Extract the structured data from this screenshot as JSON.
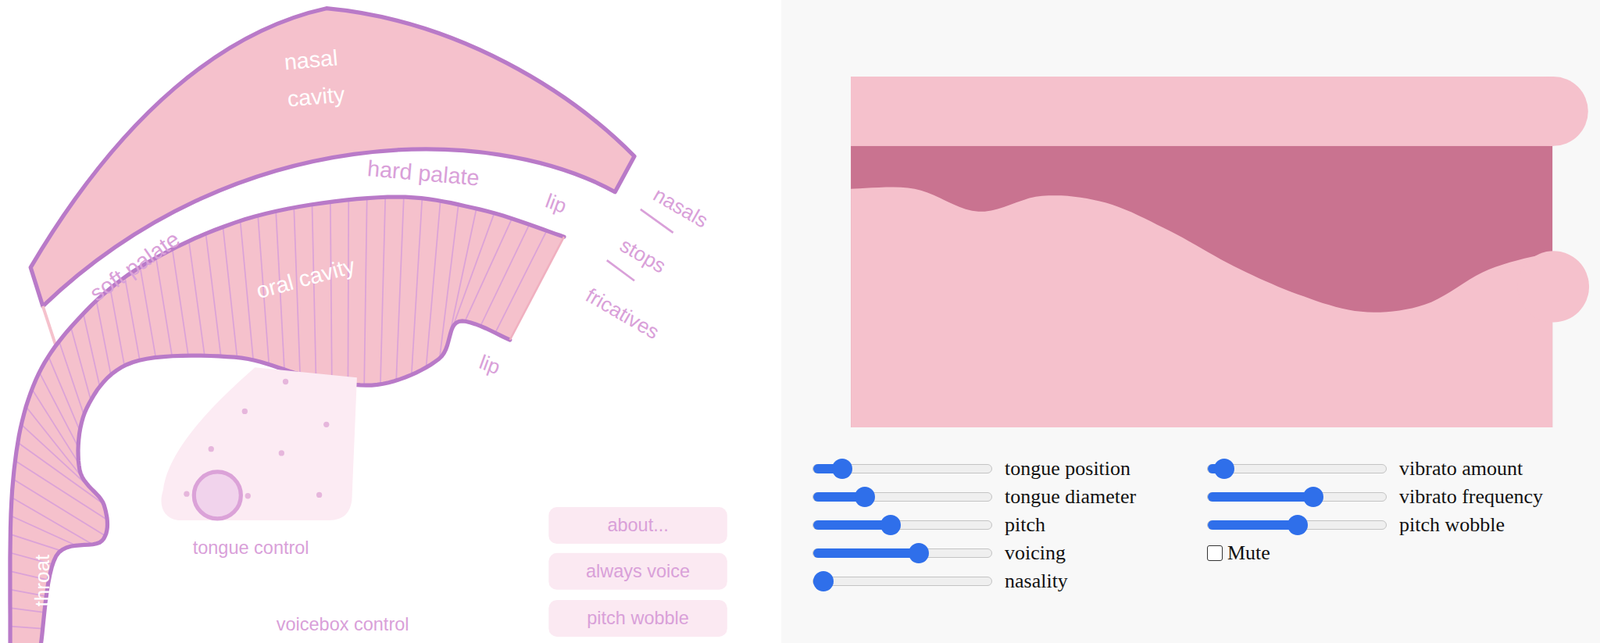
{
  "diagram": {
    "labels": [
      "nasal",
      "cavity",
      "hard palate",
      "soft palate",
      "oral cavity",
      "lip",
      "lip",
      "nasals",
      "stops",
      "fricatives",
      "throat",
      "tongue control",
      "voicebox control"
    ],
    "buttons": [
      "about...",
      "always voice",
      "pitch wobble"
    ]
  },
  "tract": {
    "profile": [
      0.32,
      0.32,
      0.385,
      0.34,
      0.36,
      0.44,
      0.54,
      0.62,
      0.67,
      0.65,
      0.55,
      0.5
    ]
  },
  "sliders_left": [
    {
      "label": "tongue position",
      "level": 0.12
    },
    {
      "label": "tongue diameter",
      "level": 0.26
    },
    {
      "label": "pitch",
      "level": 0.42
    },
    {
      "label": "voicing",
      "level": 0.6
    },
    {
      "label": "nasality",
      "level": 0
    }
  ],
  "sliders_right": [
    {
      "label": "vibrato amount",
      "level": 0.04
    },
    {
      "label": "vibrato frequency",
      "level": 0.6
    },
    {
      "label": "pitch wobble",
      "level": 0.5
    }
  ],
  "mute": {
    "label": "Mute",
    "checked": false
  }
}
